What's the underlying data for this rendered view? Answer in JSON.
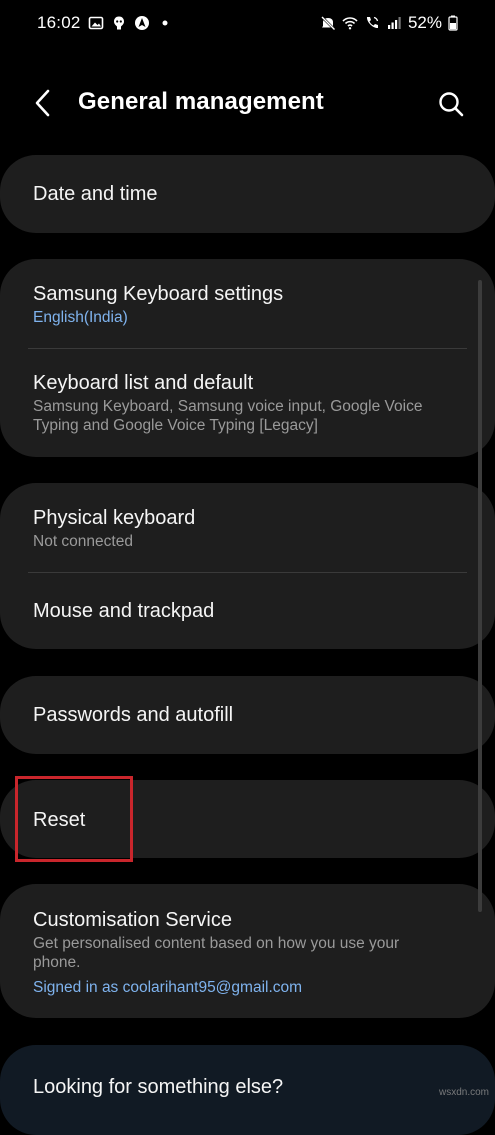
{
  "status_bar": {
    "time": "16:02",
    "battery_percent": "52%",
    "left_icons": [
      "gallery-icon",
      "notification-icon",
      "navigation-icon",
      "dot-icon"
    ],
    "right_icons": [
      "mute-icon",
      "wifi-icon",
      "wifi-call-icon",
      "signal-icon",
      "battery-icon"
    ]
  },
  "header": {
    "title": "General management",
    "back_icon": "chevron-left-icon",
    "search_icon": "search-icon"
  },
  "groups": [
    {
      "items": [
        {
          "title": "Date and time"
        }
      ]
    },
    {
      "items": [
        {
          "title": "Samsung Keyboard settings",
          "subtitle": "English(India)"
        },
        {
          "title": "Keyboard list and default",
          "subtitle_line1": "Samsung Keyboard, Samsung voice input, Google Voice",
          "subtitle_line2": "Typing and Google Voice Typing [Legacy]"
        }
      ]
    },
    {
      "items": [
        {
          "title": "Physical keyboard",
          "subtitle": "Not connected"
        },
        {
          "title": "Mouse and trackpad"
        }
      ]
    },
    {
      "items": [
        {
          "title": "Passwords and autofill"
        }
      ]
    },
    {
      "items": [
        {
          "title": "Reset"
        }
      ]
    },
    {
      "items": [
        {
          "title": "Customisation Service",
          "subtitle_line1": "Get personalised content based on how you use your",
          "subtitle_line2": "phone.",
          "account": "Signed in as coolarihant95@gmail.com"
        }
      ]
    },
    {
      "items": [
        {
          "title": "Looking for something else?"
        }
      ]
    }
  ],
  "watermark": "wsxdn.com",
  "colors": {
    "background": "#000000",
    "card": "#1e1e1e",
    "accent_blue": "#7fb3ee",
    "highlight_red": "#c9262c"
  }
}
